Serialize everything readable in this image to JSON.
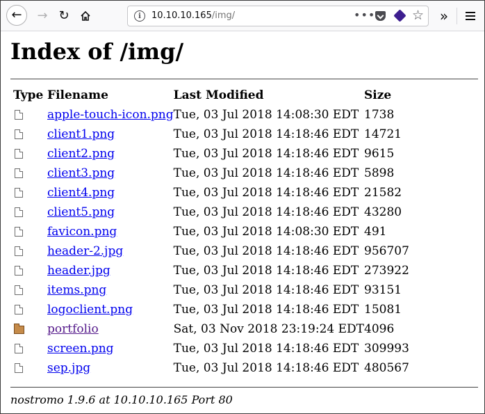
{
  "browser": {
    "url_host": "10.10.10.165",
    "url_path": "/img/",
    "url_overflow": "•••",
    "icons": [
      "back-icon",
      "forward-icon",
      "reload-icon",
      "home-icon",
      "info-icon",
      "more-icon",
      "pocket-icon",
      "extension-icon",
      "bookmark-star-icon",
      "overflow-chevron-icon",
      "hamburger-menu-icon"
    ]
  },
  "page": {
    "title": "Index of /img/",
    "columns": {
      "type": "Type",
      "filename": "Filename",
      "modified": "Last Modified",
      "size": "Size"
    },
    "entries": [
      {
        "icon": "file",
        "name": "apple-touch-icon.png",
        "modified": "Tue, 03 Jul 2018 14:08:30 EDT",
        "size": "1738"
      },
      {
        "icon": "file",
        "name": "client1.png",
        "modified": "Tue, 03 Jul 2018 14:18:46 EDT",
        "size": "14721"
      },
      {
        "icon": "file",
        "name": "client2.png",
        "modified": "Tue, 03 Jul 2018 14:18:46 EDT",
        "size": "9615"
      },
      {
        "icon": "file",
        "name": "client3.png",
        "modified": "Tue, 03 Jul 2018 14:18:46 EDT",
        "size": "5898"
      },
      {
        "icon": "file",
        "name": "client4.png",
        "modified": "Tue, 03 Jul 2018 14:18:46 EDT",
        "size": "21582"
      },
      {
        "icon": "file",
        "name": "client5.png",
        "modified": "Tue, 03 Jul 2018 14:18:46 EDT",
        "size": "43280"
      },
      {
        "icon": "file",
        "name": "favicon.png",
        "modified": "Tue, 03 Jul 2018 14:08:30 EDT",
        "size": "491"
      },
      {
        "icon": "file",
        "name": "header-2.jpg",
        "modified": "Tue, 03 Jul 2018 14:18:46 EDT",
        "size": "956707"
      },
      {
        "icon": "file",
        "name": "header.jpg",
        "modified": "Tue, 03 Jul 2018 14:18:46 EDT",
        "size": "273922"
      },
      {
        "icon": "file",
        "name": "items.png",
        "modified": "Tue, 03 Jul 2018 14:18:46 EDT",
        "size": "93151"
      },
      {
        "icon": "file",
        "name": "logoclient.png",
        "modified": "Tue, 03 Jul 2018 14:18:46 EDT",
        "size": "15081"
      },
      {
        "icon": "folder",
        "name": "portfolio",
        "modified": "Sat, 03 Nov 2018 23:19:24 EDT",
        "size": "4096",
        "visited": true
      },
      {
        "icon": "file",
        "name": "screen.png",
        "modified": "Tue, 03 Jul 2018 14:18:46 EDT",
        "size": "309993"
      },
      {
        "icon": "file",
        "name": "sep.jpg",
        "modified": "Tue, 03 Jul 2018 14:18:46 EDT",
        "size": "480567"
      }
    ],
    "footer": "nostromo 1.9.6 at 10.10.10.165 Port 80"
  },
  "colors": {
    "link": "#0000ee",
    "visited_link": "#551a8b",
    "toolbar_bg": "#f9f9fa"
  }
}
